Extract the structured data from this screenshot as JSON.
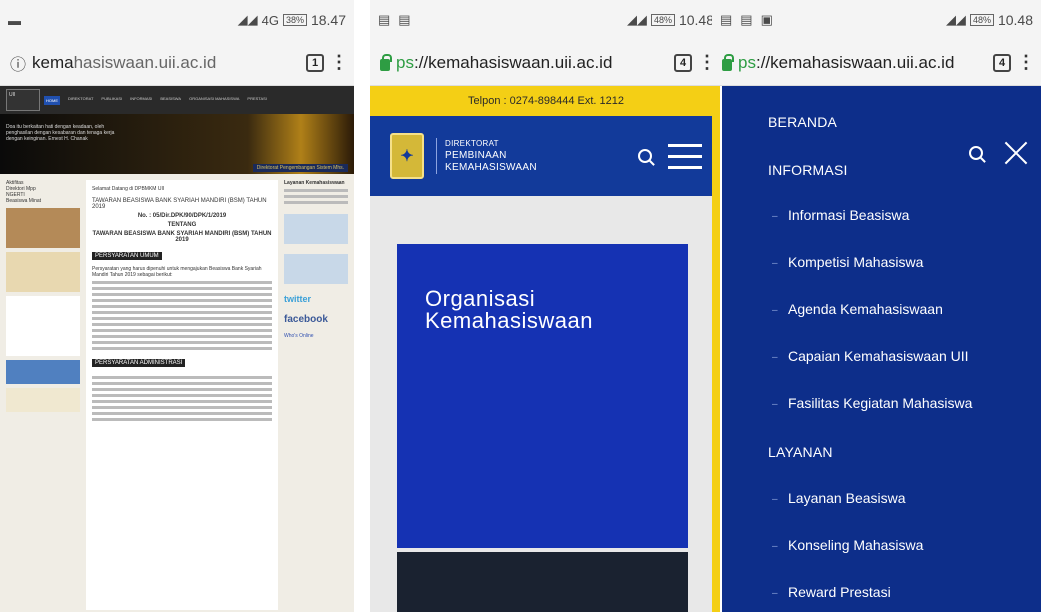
{
  "panel1": {
    "status": {
      "time": "18.47",
      "battery": "38%",
      "network": "4G"
    },
    "url": {
      "prefix": "kema",
      "host": "hasiswaan.uii.ac.id",
      "tabs": "1"
    },
    "site": {
      "nav": [
        "HOME",
        "DIREKTORAT",
        "PUBLIKASI",
        "INFORMASI",
        "BEASISWA",
        "ORGANISASI MAHASISWA",
        "PRESTASI"
      ],
      "banner_text": "Doa itu berkaitan hati dengan keadaan, oleh penghasilan dengan kesabaran dan tenaga kerja dengan keinginan. Ernest H. Chanak",
      "banner_caption": "Direktorat Pengembangan Sistem Mhs.",
      "welcome": "Selamat Datang di DPBMKM UII",
      "post_title": "TAWARAN BEASISWA BANK SYARIAH MANDIRI (BSM) TAHUN 2019",
      "doc_no": "No. : 05/Dir.DPK/90/DPK/1/2019",
      "tentang": "TENTANG",
      "doc_title": "TAWARAN BEASISWA BANK SYARIAH MANDIRI (BSM) TAHUN 2019",
      "sec1": "PERSYARATAN UMUM",
      "sec2": "PERSYARATAN ADMINISTRASI",
      "intro": "Persyaratan yang harus dipenuhi untuk mengajukan Beasiswa Bank Syariah Mandiri Tahun 2019 sebagai berikut:",
      "sidebar": [
        "Aktifitas",
        "Direktori Mpp",
        "NGERTI",
        "Beasiswa Minat"
      ],
      "right_title": "Layanan Kemahasiswaan",
      "facebook": "facebook",
      "twitter": "twitter",
      "whos_online": "Who's Online"
    }
  },
  "panel2": {
    "status": {
      "time": "10.48",
      "battery": "48%"
    },
    "url": {
      "prefix": "ps",
      "host": "://kemahasiswaan.uii.ac.id",
      "tabs": "4"
    },
    "phone": "Telpon : 0274-898444 Ext. 1212",
    "logo": {
      "line1": "DIREKTORAT",
      "line2": "PEMBINAAN",
      "line3": "KEMAHASISWAAN"
    },
    "card_title_1": "Organisasi",
    "card_title_2": "Kemahasiswaan"
  },
  "panel3": {
    "status": {
      "time": "10.48",
      "battery": "48%"
    },
    "url": {
      "prefix": "ps",
      "host": "://kemahasiswaan.uii.ac.id",
      "tabs": "4"
    },
    "menu": {
      "beranda": "BERANDA",
      "informasi": "INFORMASI",
      "informasi_items": [
        "Informasi Beasiswa",
        "Kompetisi Mahasiswa",
        "Agenda Kemahasiswaan",
        "Capaian Kemahasiswaan UII",
        "Fasilitas Kegiatan Mahasiswa"
      ],
      "layanan": "LAYANAN",
      "layanan_items": [
        "Layanan Beasiswa",
        "Konseling Mahasiswa",
        "Reward Prestasi"
      ]
    }
  },
  "colors": {
    "brand_blue": "#123a9a",
    "menu_blue": "#0d2e8a",
    "yellow": "#f4cf15",
    "lock_green": "#2e9d43"
  }
}
